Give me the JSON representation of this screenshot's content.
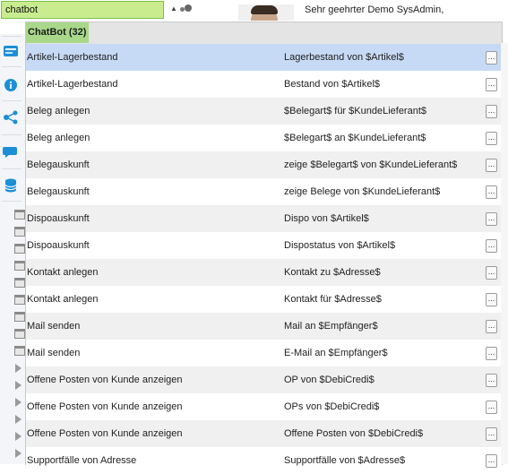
{
  "search": {
    "value": "chatbot",
    "placeholder": ""
  },
  "greeting": "Sehr geehrter Demo SysAdmin,",
  "list": {
    "group_label": "ChatBot (32)",
    "more_label": "...",
    "rows": [
      {
        "name": "Artikel-Lagerbestand",
        "phrase": "Lagerbestand von $Artikel$",
        "selected": true
      },
      {
        "name": "Artikel-Lagerbestand",
        "phrase": "Bestand von $Artikel$"
      },
      {
        "name": "Beleg anlegen",
        "phrase": "$Belegart$ für $KundeLieferant$"
      },
      {
        "name": "Beleg anlegen",
        "phrase": "$Belegart$ an $KundeLieferant$"
      },
      {
        "name": "Belegauskunft",
        "phrase": "zeige $Belegart$ von $KundeLieferant$"
      },
      {
        "name": "Belegauskunft",
        "phrase": "zeige Belege von $KundeLieferant$"
      },
      {
        "name": "Dispoauskunft",
        "phrase": "Dispo von $Artikel$"
      },
      {
        "name": "Dispoauskunft",
        "phrase": "Dispostatus von $Artikel$"
      },
      {
        "name": "Kontakt anlegen",
        "phrase": "Kontakt zu $Adresse$"
      },
      {
        "name": "Kontakt anlegen",
        "phrase": "Kontakt für $Adresse$"
      },
      {
        "name": "Mail senden",
        "phrase": "Mail an $Empfänger$"
      },
      {
        "name": "Mail senden",
        "phrase": "E-Mail an $Empfänger$"
      },
      {
        "name": "Offene Posten von Kunde anzeigen",
        "phrase": "OP von $DebiCredi$"
      },
      {
        "name": "Offene Posten von Kunde anzeigen",
        "phrase": "OPs von $DebiCredi$"
      },
      {
        "name": "Offene Posten von Kunde anzeigen",
        "phrase": "Offene Posten von $DebiCredi$"
      },
      {
        "name": "Supportfälle von Adresse",
        "phrase": "Supportfälle von $Adresse$"
      }
    ]
  },
  "colors": {
    "accent_green": "#a9d88a",
    "search_bg": "#c8ec8e",
    "selected_row": "#c7daf5",
    "icon_blue": "#1c8fd6"
  },
  "icons": [
    "web-icon",
    "info-icon",
    "share-icon",
    "chat-icon",
    "database-icon"
  ]
}
